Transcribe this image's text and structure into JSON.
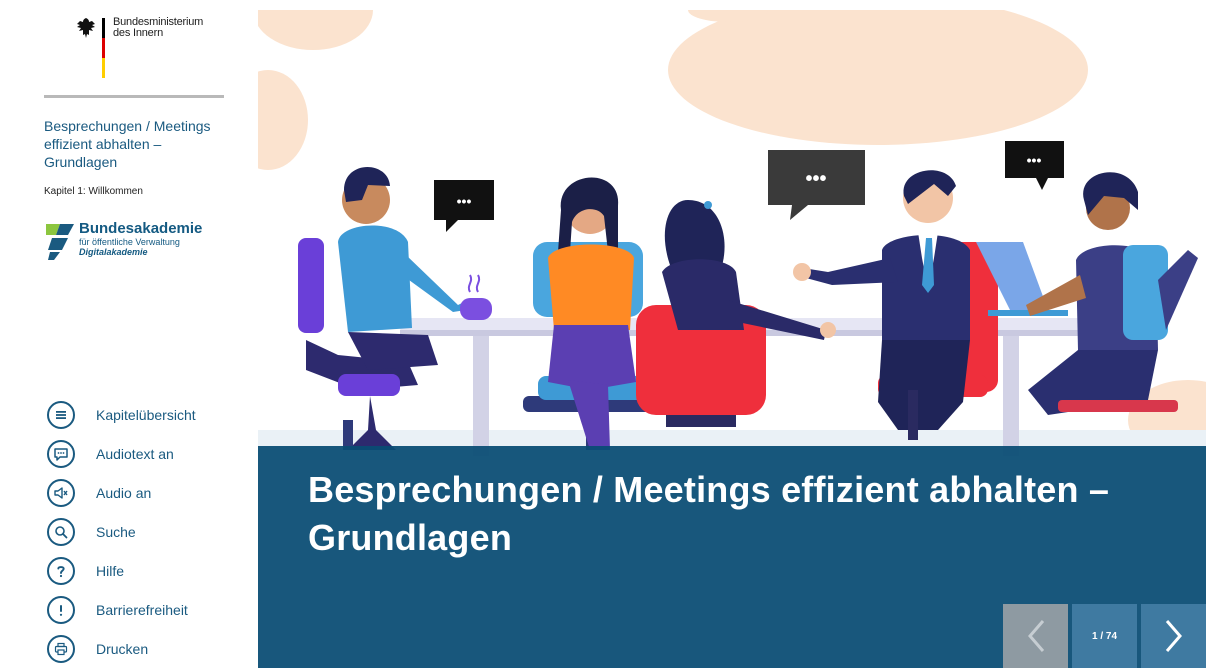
{
  "branding": {
    "ministry_line1": "Bundesministerium",
    "ministry_line2": "des Innern",
    "academy_name": "Bundesakademie",
    "academy_sub": "für öffentliche Verwaltung",
    "academy_digital": "Digitalakademie"
  },
  "course": {
    "title": "Besprechungen / Meetings effizient abhalten – Grundlagen",
    "chapter": "Kapitel 1: Willkommen"
  },
  "menu": [
    {
      "label": "Kapitelübersicht",
      "icon": "list-icon"
    },
    {
      "label": "Audiotext an",
      "icon": "speech-bubble-icon"
    },
    {
      "label": "Audio an",
      "icon": "speaker-mute-icon"
    },
    {
      "label": "Suche",
      "icon": "search-icon"
    },
    {
      "label": "Hilfe",
      "icon": "help-icon"
    },
    {
      "label": "Barrierefreiheit",
      "icon": "exclamation-icon"
    },
    {
      "label": "Drucken",
      "icon": "printer-icon"
    }
  ],
  "slide": {
    "title": "Besprechungen / Meetings effizient abhalten – Grundlagen",
    "speech_bubble_text": "•••",
    "page_counter": "1 / 74"
  },
  "colors": {
    "brand_blue": "#1a5a80",
    "banner_blue": "#0a4d74",
    "nav_active": "#3f7aa1",
    "nav_disabled": "#8e9aa2"
  }
}
